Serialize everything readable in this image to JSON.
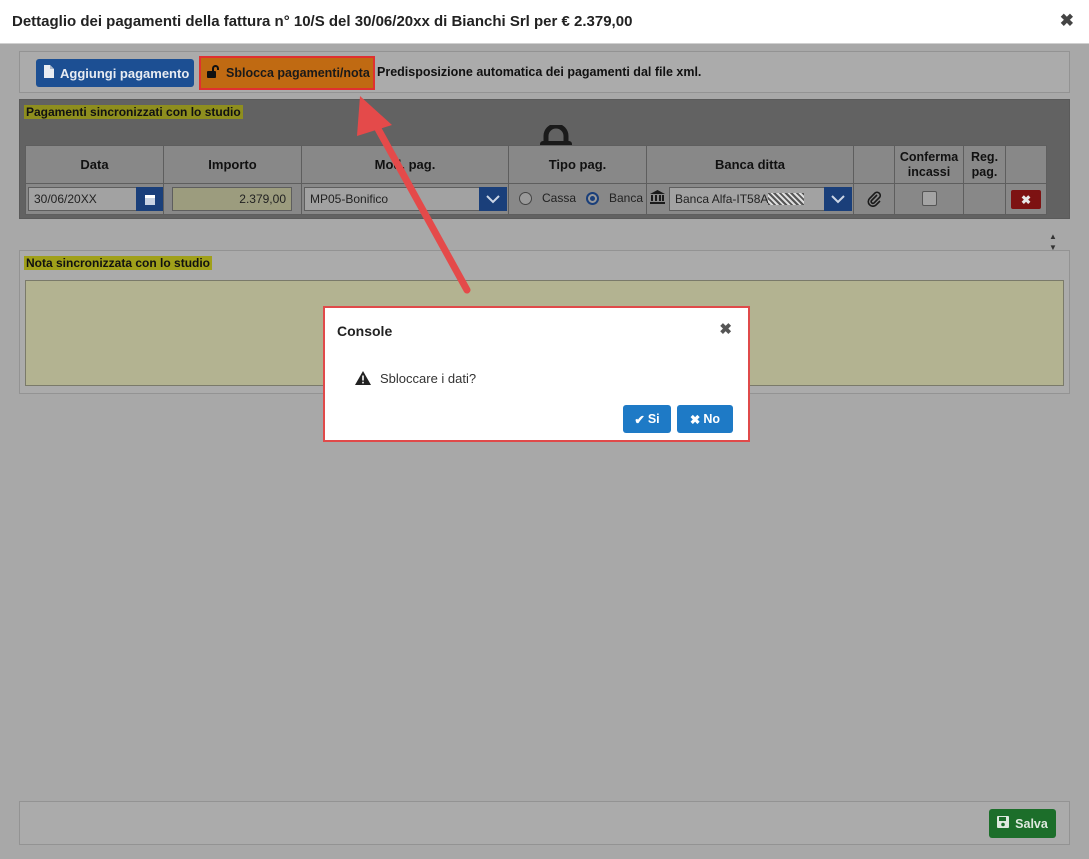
{
  "header": {
    "title": "Dettaglio dei pagamenti della fattura n° 10/S del 30/06/20xx di Bianchi Srl per € 2.379,00",
    "close_glyph": "✖"
  },
  "toolbar": {
    "add_payment_label": "Aggiungi pagamento",
    "unlock_label": "Sblocca pagamenti/nota",
    "info_text": "Predisposizione automatica dei pagamenti dal file xml."
  },
  "sync_payments": {
    "label": "Pagamenti sincronizzati con lo studio",
    "columns": {
      "data": "Data",
      "importo": "Importo",
      "mod_pag": "Mod. pag.",
      "tipo_pag": "Tipo pag.",
      "banca_ditta": "Banca ditta",
      "conferma_incassi_1": "Conferma",
      "conferma_incassi_2": "incassi",
      "reg_pag_1": "Reg.",
      "reg_pag_2": "pag."
    },
    "row": {
      "data": "30/06/20XX",
      "importo": "2.379,00",
      "mod_pag": "MP05-Bonifico",
      "tipo_cassa": "Cassa",
      "tipo_banca": "Banca",
      "tipo_selected": "Banca",
      "banca": "Banca Alfa-IT58A",
      "delete_glyph": "✖"
    }
  },
  "nota": {
    "label": "Nota sincronizzata con lo studio",
    "value": ""
  },
  "footer": {
    "save_label": "Salva"
  },
  "dialog": {
    "title": "Console",
    "close_glyph": "✖",
    "message": "Sbloccare i dati?",
    "yes_label": "Si",
    "no_label": "No"
  },
  "colors": {
    "primary": "#1e7ac6",
    "highlight_border": "#e04a4a",
    "save": "#1c6e2a"
  },
  "icons": [
    "file-icon",
    "unlock-icon",
    "lock-icon",
    "calendar-icon",
    "chevron-down-icon",
    "bank-icon",
    "paperclip-icon",
    "close-icon",
    "warning-icon",
    "check-icon",
    "save-icon"
  ]
}
